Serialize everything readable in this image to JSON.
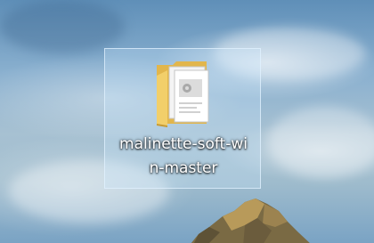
{
  "desktop": {
    "icons": [
      {
        "type": "folder",
        "icon": "folder-icon",
        "label_line1": "malinette-soft-wi",
        "label_line2": "n-master",
        "selected": true
      }
    ]
  }
}
